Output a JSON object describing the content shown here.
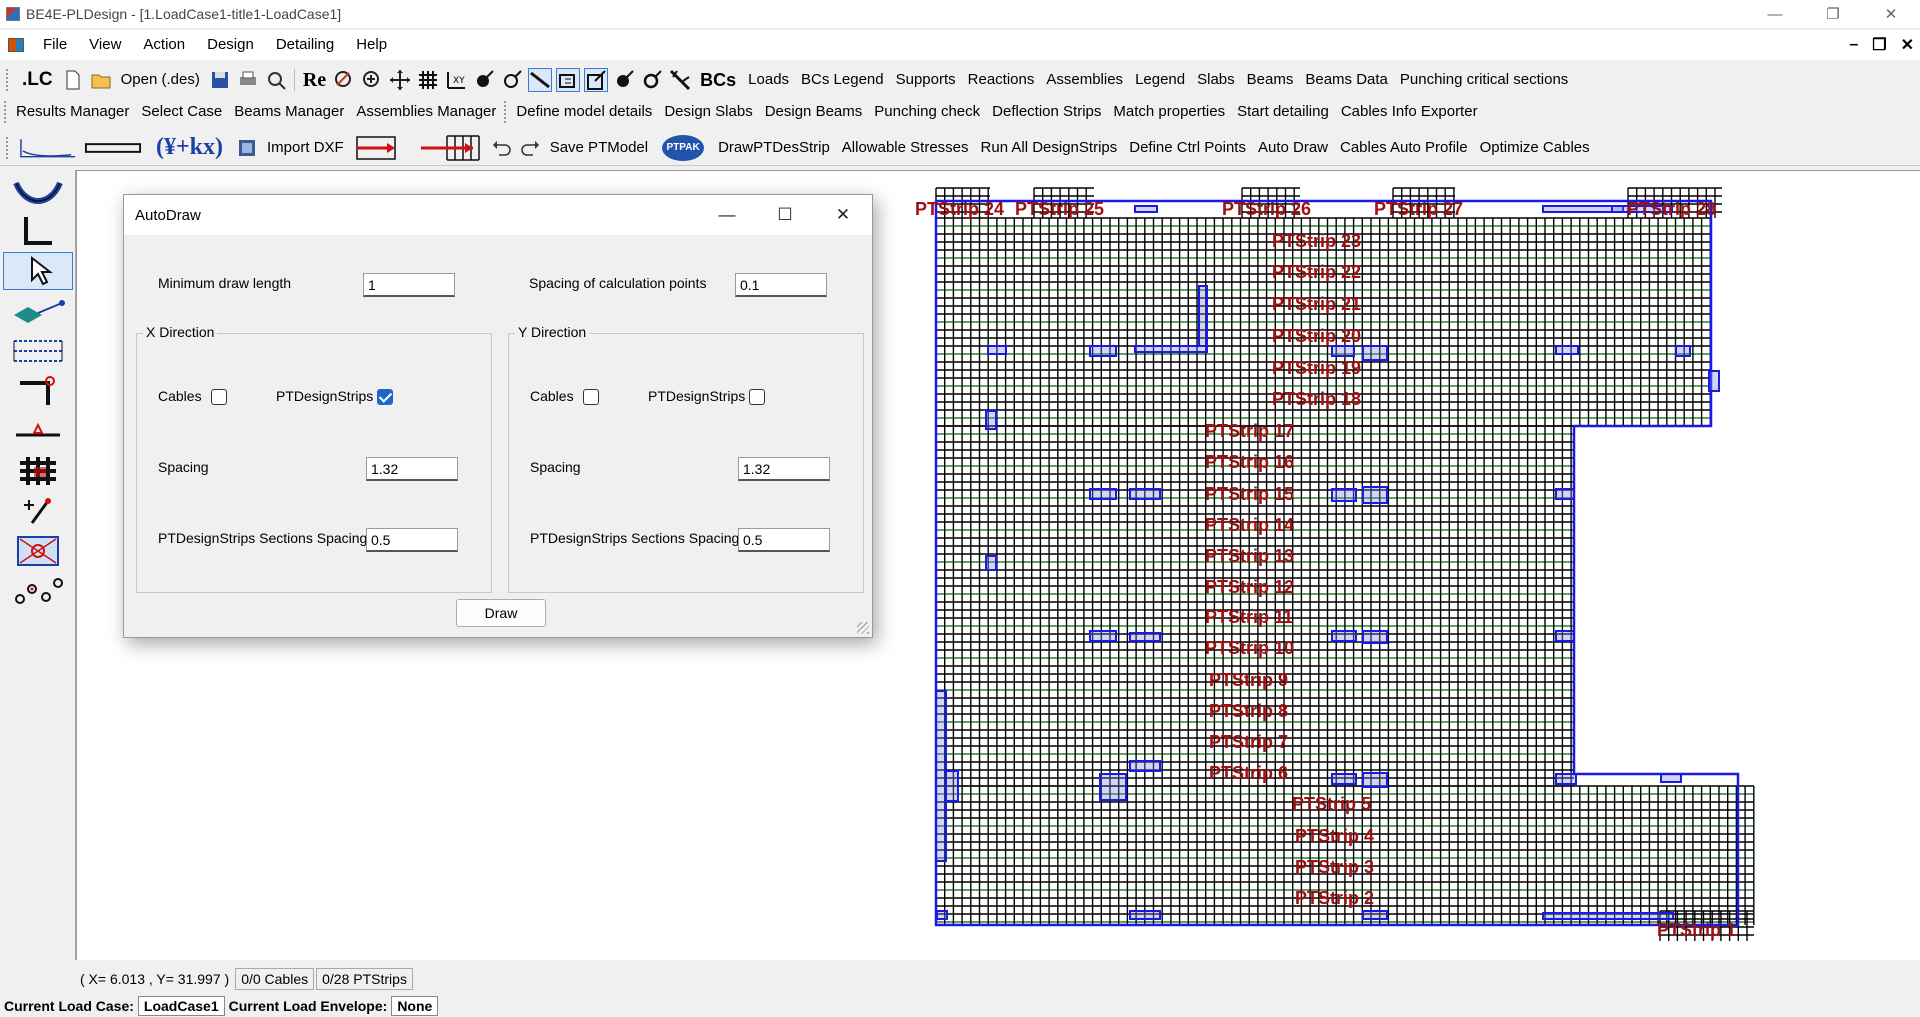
{
  "window": {
    "title": "BE4E-PLDesign - [1.LoadCase1-title1-LoadCase1]"
  },
  "menu": [
    "File",
    "View",
    "Action",
    "Design",
    "Detailing",
    "Help"
  ],
  "toolbar1": {
    "lc": ".LC",
    "open": "Open (.des)",
    "re": "Re",
    "bcs": "BCs",
    "items": [
      "Loads",
      "BCs Legend",
      "Supports",
      "Reactions",
      "Assemblies",
      "Legend",
      "Slabs",
      "Beams",
      "Beams Data",
      "Punching critical sections"
    ]
  },
  "toolbar2": {
    "items": [
      "Results Manager",
      "Select Case",
      "Beams Manager",
      "Assemblies Manager",
      "Define model details",
      "Design Slabs",
      "Design Beams",
      "Punching check",
      "Deflection Strips",
      "Match properties",
      "Start detailing",
      "Cables Info Exporter"
    ]
  },
  "toolbar3": {
    "formula": "(¥+kx)",
    "import_dxf": "Import DXF",
    "save_ptmodel": "Save PTModel",
    "ptpak": "PTPAK",
    "items": [
      "DrawPTDesStrip",
      "Allowable Stresses",
      "Run All DesignStrips",
      "Define Ctrl Points",
      "Auto Draw",
      "Cables Auto Profile",
      "Optimize Cables"
    ]
  },
  "dialog": {
    "title": "AutoDraw",
    "min_draw_length_label": "Minimum draw length",
    "min_draw_length": "1",
    "spacing_calc_label": "Spacing of calculation points",
    "spacing_calc": "0.1",
    "x": {
      "title": "X Direction",
      "cables_label": "Cables",
      "cables_checked": false,
      "ptds_label": "PTDesignStrips",
      "ptds_checked": true,
      "spacing_label": "Spacing",
      "spacing": "1.32",
      "sections_label": "PTDesignStrips Sections Spacing",
      "sections": "0.5"
    },
    "y": {
      "title": "Y Direction",
      "cables_label": "Cables",
      "cables_checked": false,
      "ptds_label": "PTDesignStrips",
      "ptds_checked": false,
      "spacing_label": "Spacing",
      "spacing": "1.32",
      "sections_label": "PTDesignStrips Sections Spacing",
      "sections": "0.5"
    },
    "draw_button": "Draw"
  },
  "strips": [
    "PTStrip 24",
    "PTStrip 25",
    "PTStrip 26",
    "PTStrip 27",
    "PTStrip 28",
    "PTStrip 23",
    "PTStrip 22",
    "PTStrip 21",
    "PTStrip 20",
    "PTStrip 19",
    "PTStrip 18",
    "PTStrip 17",
    "PTStrip 16",
    "PTStrip 15",
    "PTStrip 14",
    "PTStrip 13",
    "PTStrip 12",
    "PTStrip 11",
    "PTStrip 10",
    "PTStrip 9",
    "PTStrip 8",
    "PTStrip 7",
    "PTStrip 6",
    "PTStrip 5",
    "PTStrip 4",
    "PTStrip 3",
    "PTStrip 2",
    "PTStrip 1"
  ],
  "status": {
    "coords": "( X= 6.013 , Y= 31.997 )",
    "cables": "0/0 Cables",
    "ptstrips": "0/28 PTStrips",
    "current_load_case_label": "Current Load Case:",
    "current_load_case": "LoadCase1",
    "current_load_envelope_label": "Current Load Envelope:",
    "current_load_envelope": "None"
  },
  "colors": {
    "grid_black": "#000000",
    "grid_green": "#2e7d32",
    "outline_blue": "#1a1ae6",
    "label_red": "#a01010"
  }
}
